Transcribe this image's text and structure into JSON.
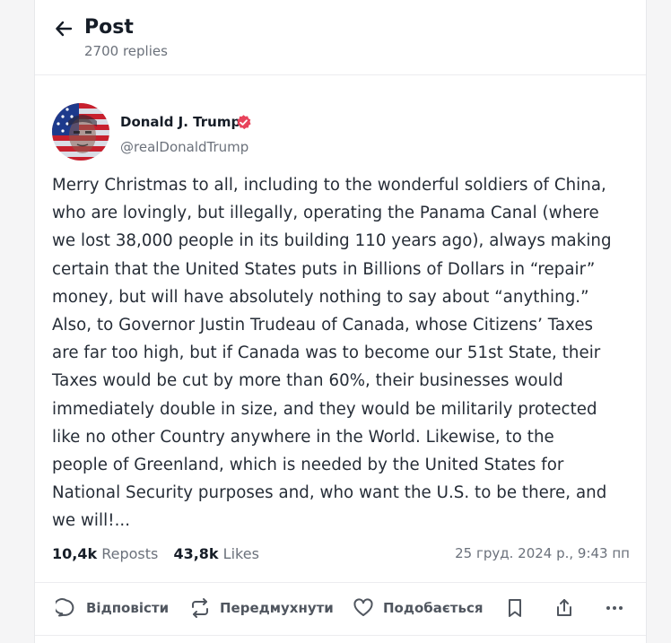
{
  "header": {
    "title": "Post",
    "subtitle": "2700 replies"
  },
  "author": {
    "name": "Donald J. Trump",
    "handle": "@realDonaldTrump"
  },
  "post": {
    "text": "Merry Christmas to all, including to the wonderful soldiers of China,\nwho are lovingly, but illegally, operating the Panama Canal (where\nwe lost 38,000 people in its building 110 years ago), always making\ncertain that the United States puts in Billions of Dollars in “repair”\nmoney, but will have absolutely nothing to say about “anything.”\nAlso, to Governor Justin Trudeau of Canada, whose Citizens’ Taxes\nare far too high, but if Canada was to become our 51st State, their\nTaxes would be cut by more than 60%, their businesses would\nimmediately double in size, and they would be militarily protected\nlike no other Country anywhere in the World. Likewise, to the\npeople of Greenland, which is needed by the United States for\nNational Security purposes and, who want the U.S. to be there, and\nwe will!..."
  },
  "stats": {
    "reposts_count": "10,4k",
    "reposts_label": "Reposts",
    "likes_count": "43,8k",
    "likes_label": "Likes",
    "timestamp": "25 груд. 2024 р., 9:43 пп"
  },
  "actions": {
    "reply": "Відповісти",
    "repost": "Передмухнути",
    "like": "Подобається"
  },
  "icons": {
    "back": "arrow-left-icon",
    "verified": "verified-badge-icon",
    "reply": "speech-bubble-icon",
    "repost": "repost-arrows-icon",
    "like": "heart-icon",
    "bookmark": "bookmark-icon",
    "share": "share-icon",
    "more": "more-dots-icon"
  },
  "colors": {
    "verified_badge": "#e8435b",
    "text": "#161d27",
    "muted": "#6b717b"
  }
}
